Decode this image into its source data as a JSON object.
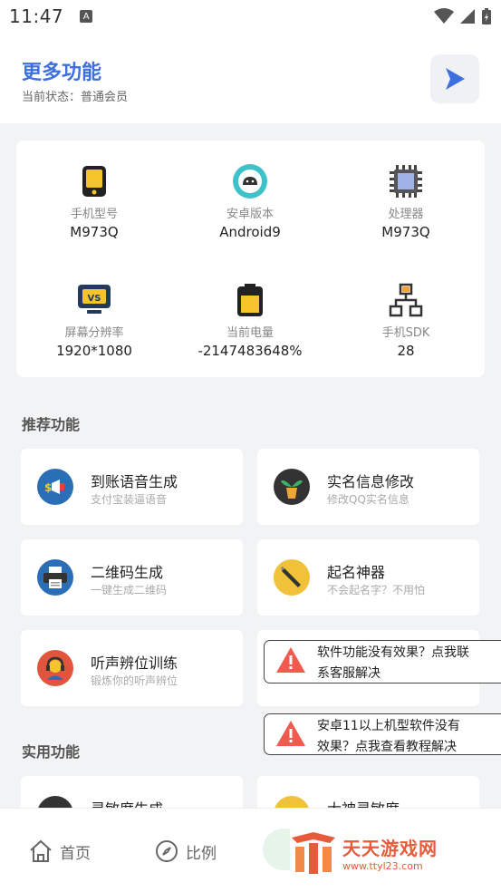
{
  "status_bar": {
    "time": "11:47",
    "badge": "A"
  },
  "header": {
    "title": "更多功能",
    "subtitle": "当前状态：普通会员"
  },
  "device_info": [
    {
      "label": "手机型号",
      "value": "M973Q",
      "icon": "phone-icon"
    },
    {
      "label": "安卓版本",
      "value": "Android9",
      "icon": "android-icon"
    },
    {
      "label": "处理器",
      "value": "M973Q",
      "icon": "cpu-icon"
    },
    {
      "label": "屏幕分辨率",
      "value": "1920*1080",
      "icon": "screen-icon"
    },
    {
      "label": "当前电量",
      "value": "-2147483648%",
      "icon": "battery-icon"
    },
    {
      "label": "手机SDK",
      "value": "28",
      "icon": "sdk-icon"
    }
  ],
  "sections": {
    "recommended": "推荐功能",
    "practical": "实用功能"
  },
  "recommended_features": [
    {
      "title": "到账语音生成",
      "subtitle": "支付宝装逼语音"
    },
    {
      "title": "实名信息修改",
      "subtitle": "修改QQ实名信息"
    },
    {
      "title": "二维码生成",
      "subtitle": "一键生成二维码"
    },
    {
      "title": "起名神器",
      "subtitle": "不会起名字？不用怕"
    },
    {
      "title": "听声辨位训练",
      "subtitle": "锻炼你的听声辨位"
    }
  ],
  "practical_features": [
    {
      "title": "灵敏度生成"
    },
    {
      "title": "大神灵敏度"
    }
  ],
  "toasts": [
    {
      "line1": "软件功能没有效果？点我联",
      "line2": "系客服解决"
    },
    {
      "line1": "安卓11以上机型软件没有",
      "line2": "效果？点我查看教程解决"
    }
  ],
  "nav": {
    "home": "首页",
    "ratio": "比例"
  },
  "watermark": {
    "name": "天天游戏网",
    "url": "www.ttyl23.com"
  },
  "colors": {
    "accent": "#3d6fe0",
    "warning": "#f05a4f",
    "watermark": "#e85b3a"
  }
}
